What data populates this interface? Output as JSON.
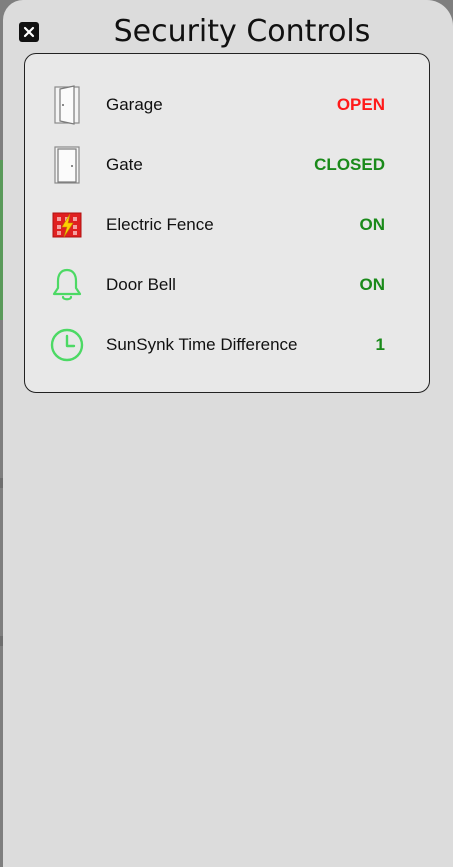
{
  "title": "Security Controls",
  "close_icon": "close-icon",
  "colors": {
    "open": "#ff1a1a",
    "closed": "#1a8a1a",
    "on": "#1a8a1a",
    "value": "#1a8a1a",
    "icon_green": "#4cd964"
  },
  "items": [
    {
      "label": "Garage",
      "value": "OPEN",
      "icon": "door-open-icon",
      "status_color": "#ff1a1a"
    },
    {
      "label": "Gate",
      "value": "CLOSED",
      "icon": "door-closed-icon",
      "status_color": "#1a8a1a"
    },
    {
      "label": "Electric Fence",
      "value": "ON",
      "icon": "electric-fence-icon",
      "status_color": "#1a8a1a"
    },
    {
      "label": "Door Bell",
      "value": "ON",
      "icon": "bell-icon",
      "status_color": "#1a8a1a"
    },
    {
      "label": "SunSynk Time Difference",
      "value": "1",
      "icon": "clock-icon",
      "status_color": "#1a8a1a"
    }
  ]
}
